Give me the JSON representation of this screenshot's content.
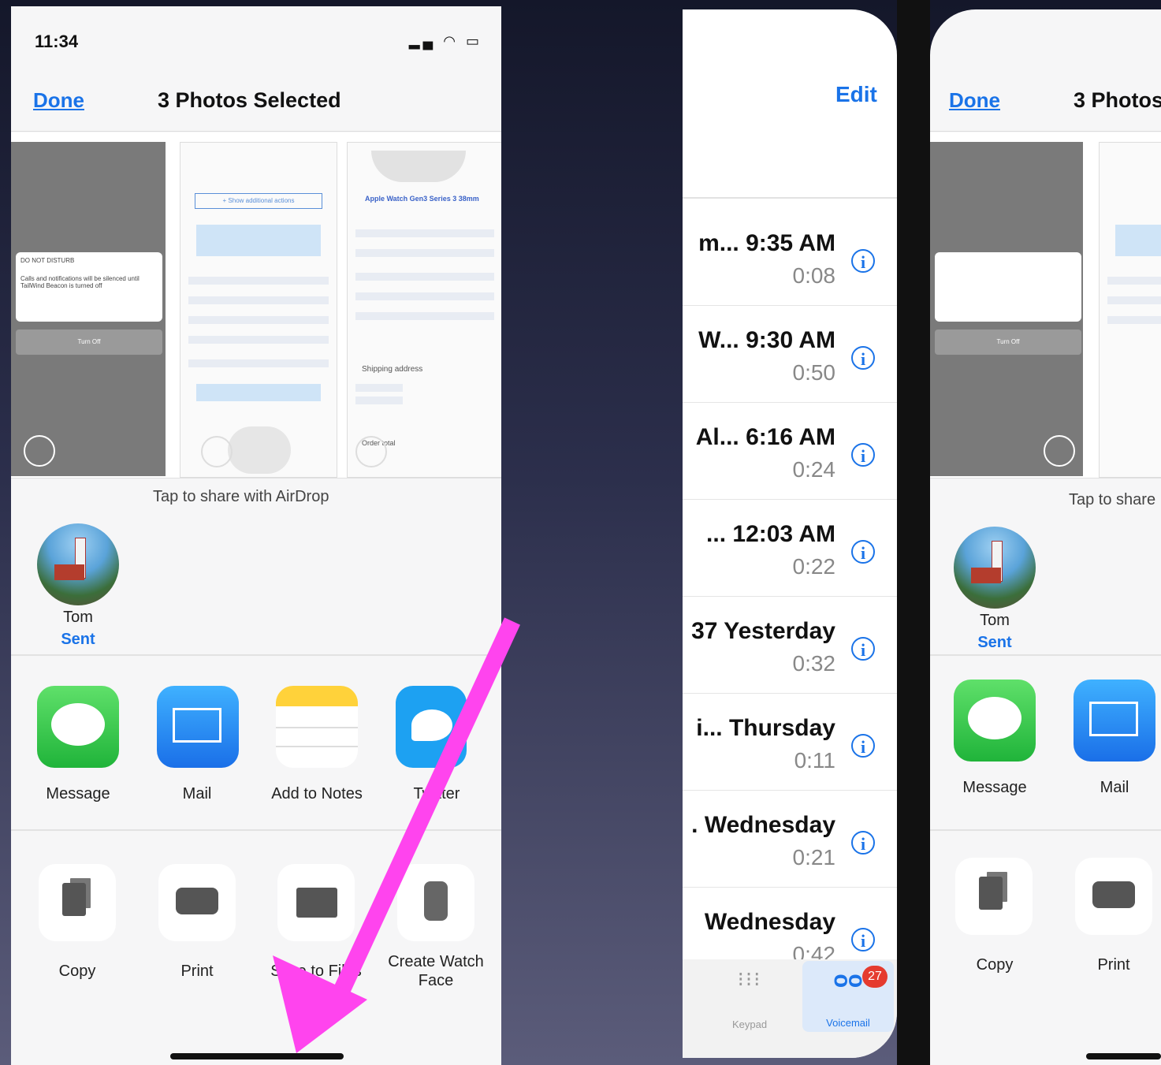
{
  "share_sheet": {
    "status_time": "11:34",
    "done_label": "Done",
    "title": "3 Photos Selected",
    "thumb_dnd_title": "DO NOT DISTURB",
    "thumb_dnd_text": "Calls and notifications will be silenced until TailWind Beacon is turned off",
    "thumb_dnd_button": "Turn Off",
    "thumb_show_actions": "+ Show additional actions",
    "thumb_product": "Apple Watch Gen3 Series 3 38mm",
    "thumb_shipping": "Shipping address",
    "thumb_order": "Order total",
    "airdrop_label": "Tap to share with AirDrop",
    "contact_name": "Tom",
    "contact_status": "Sent",
    "apps": [
      "Message",
      "Mail",
      "Add to Notes",
      "Twitter"
    ],
    "actions": [
      "Copy",
      "Print",
      "Save to Files",
      "Create Watch Face"
    ]
  },
  "voicemail": {
    "edit_label": "Edit",
    "rows": [
      {
        "title": "m... 9:35 AM",
        "duration": "0:08"
      },
      {
        "title": "W... 9:30 AM",
        "duration": "0:50"
      },
      {
        "title": "Al... 6:16 AM",
        "duration": "0:24"
      },
      {
        "title": "...   12:03 AM",
        "duration": "0:22"
      },
      {
        "title": "37 Yesterday",
        "duration": "0:32"
      },
      {
        "title": "i... Thursday",
        "duration": "0:11"
      },
      {
        "title": ". Wednesday",
        "duration": "0:21"
      },
      {
        "title": "Wednesday",
        "duration": "0:42"
      }
    ],
    "info_glyph": "i",
    "tabs": [
      "Keypad",
      "Voicemail"
    ],
    "badge_count": "27"
  },
  "share_sheet_right": {
    "done_label": "Done",
    "title": "3 Photos",
    "airdrop_label": "Tap to share",
    "contact_name": "Tom",
    "contact_status": "Sent",
    "apps": [
      "Message",
      "Mail"
    ],
    "actions": [
      "Copy",
      "Print"
    ]
  },
  "colors": {
    "accent": "#1a73e8",
    "arrow": "#ff44ee",
    "badge": "#e53b2f"
  }
}
